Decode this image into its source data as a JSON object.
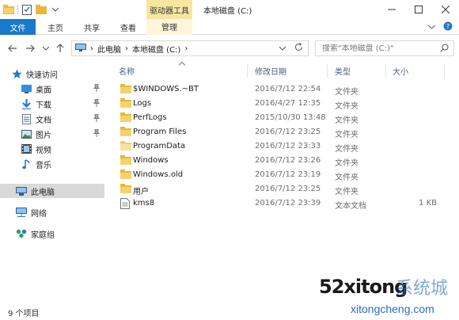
{
  "window": {
    "context_tab": "驱动器工具",
    "title": "本地磁盘 (C:)"
  },
  "ribbon": {
    "tabs": [
      "文件",
      "主页",
      "共享",
      "查看",
      "管理"
    ]
  },
  "address": {
    "crumbs": [
      "此电脑",
      "本地磁盘 (C:)"
    ]
  },
  "search": {
    "placeholder": "搜索\"本地磁盘 (C:)\""
  },
  "nav": {
    "quick_access": "快速访问",
    "items": [
      {
        "label": "桌面",
        "icon": "desktop-icon",
        "pinned": true
      },
      {
        "label": "下载",
        "icon": "download-icon",
        "pinned": true
      },
      {
        "label": "文档",
        "icon": "documents-icon",
        "pinned": true
      },
      {
        "label": "图片",
        "icon": "pictures-icon",
        "pinned": true
      },
      {
        "label": "视频",
        "icon": "video-icon",
        "pinned": false
      },
      {
        "label": "音乐",
        "icon": "music-icon",
        "pinned": false
      }
    ],
    "this_pc": "此电脑",
    "network": "网络",
    "homegroup": "家庭组"
  },
  "columns": {
    "name": "名称",
    "date": "修改日期",
    "type": "类型",
    "size": "大小"
  },
  "files": [
    {
      "name": "$WINDOWS.~BT",
      "date": "2016/7/12 22:54",
      "type": "文件夹",
      "size": "",
      "icon": "folder-icon"
    },
    {
      "name": "Logs",
      "date": "2016/4/27 12:35",
      "type": "文件夹",
      "size": "",
      "icon": "folder-icon"
    },
    {
      "name": "PerfLogs",
      "date": "2015/10/30 13:48",
      "type": "文件夹",
      "size": "",
      "icon": "folder-icon"
    },
    {
      "name": "Program Files",
      "date": "2016/7/12 23:25",
      "type": "文件夹",
      "size": "",
      "icon": "folder-icon"
    },
    {
      "name": "ProgramData",
      "date": "2016/7/12 23:33",
      "type": "文件夹",
      "size": "",
      "icon": "folder-icon"
    },
    {
      "name": "Windows",
      "date": "2016/7/12 23:26",
      "type": "文件夹",
      "size": "",
      "icon": "folder-icon"
    },
    {
      "name": "Windows.old",
      "date": "2016/7/12 23:19",
      "type": "文件夹",
      "size": "",
      "icon": "folder-icon"
    },
    {
      "name": "用户",
      "date": "2016/7/12 23:25",
      "type": "文件夹",
      "size": "",
      "icon": "folder-icon"
    },
    {
      "name": "kms8",
      "date": "2016/7/12 23:39",
      "type": "文本文档",
      "size": "1 KB",
      "icon": "text-file-icon"
    }
  ],
  "status": {
    "count": "9 个项目"
  },
  "watermark": {
    "big": "52xitong",
    "cn": "系统城",
    "url": "xitongcheng.com"
  },
  "colors": {
    "file_tab": "#1979ca",
    "context_tab": "#f7e6a2",
    "folder": "#f2c94c",
    "selected_nav": "#d9d9d9"
  }
}
